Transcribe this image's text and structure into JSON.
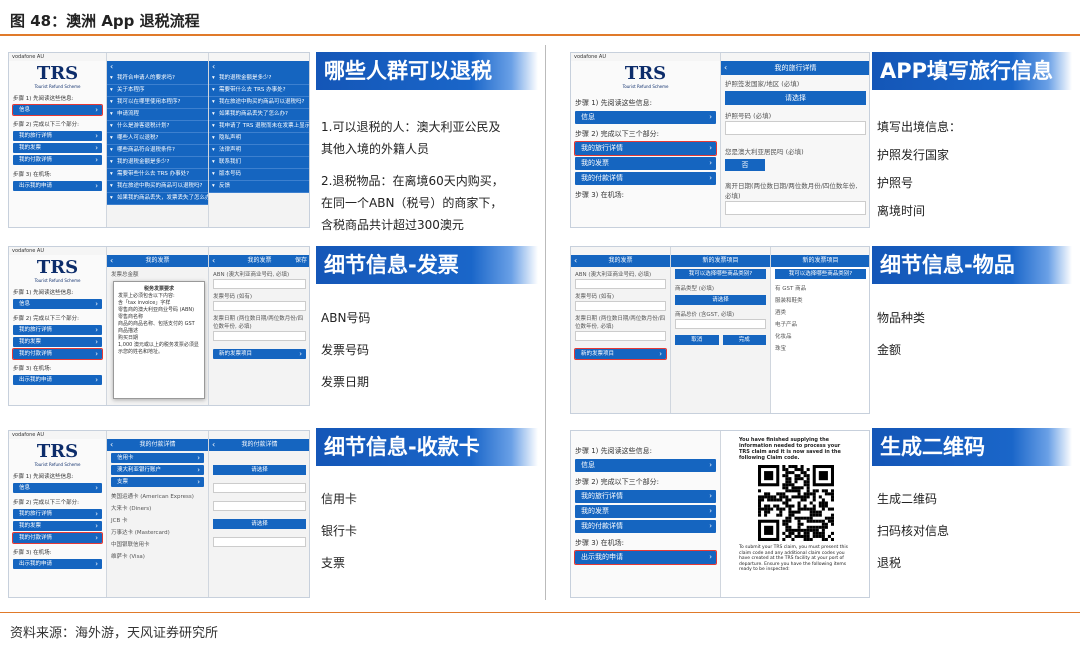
{
  "figure_title": "图 48：澳洲 App 退税流程",
  "source": "资料来源：海外游，天风证券研究所",
  "sections": {
    "who": {
      "heading": "哪些人群可以退税",
      "lines": [
        "1.可以退税的人：澳大利亚公民及其他入境的外籍人员",
        "2.退税物品：在离境60天内购买，在同一个ABN（税号）的商家下，含税商品共计超过300澳元"
      ]
    },
    "travel": {
      "heading": "APP填写旅行信息",
      "lines": [
        "填写出境信息：",
        "护照发行国家",
        "护照号",
        "离境时间"
      ]
    },
    "invoice": {
      "heading": "细节信息-发票",
      "lines": [
        "ABN号码",
        "发票号码",
        "发票日期"
      ]
    },
    "goods": {
      "heading": "细节信息-物品",
      "lines": [
        "物品种类",
        "金额"
      ]
    },
    "card": {
      "heading": "细节信息-收款卡",
      "lines": [
        "信用卡",
        "银行卡",
        "支票"
      ]
    },
    "qr": {
      "heading": "生成二维码",
      "lines": [
        "生成二维码",
        "扫码核对信息",
        "退税"
      ]
    }
  },
  "app": {
    "carrier": "vodafone AU",
    "logo": "TRS",
    "logo_sub": "Tourist Refund Scheme",
    "step1": "步骤 1) 先阅读这些信息:",
    "info_btn": "信息",
    "step2": "步骤 2) 完成以下三个部分:",
    "my_travel": "我的旅行详情",
    "my_invoice": "我的发票",
    "my_payment": "我的付款详情",
    "step3": "步骤 3) 在机场:",
    "show_claim": "出示我的申请",
    "faq_items": [
      "我符合申请人的要求吗?",
      "关于本程序",
      "我可以在哪里使用本程序?",
      "申请流程",
      "什么是游客退税计划?",
      "哪些人可以退税?",
      "哪些商品符合退税条件?",
      "我的退税金额是多少?",
      "需要带些什么去 TRS 办事处?",
      "我在旅途中购买的商品可以退税吗?",
      "如果我的商品丢失，发票丢失了怎么办?"
    ],
    "faq_items2": [
      "我的退税金额是多少?",
      "需要带什么去 TRS 办事处?",
      "我在旅途中购买的商品可以退税吗?",
      "如果我的商品丢失了怎么办?",
      "我申请了 TRS 退税而未在发票上显示怎么办?",
      "隐私声明",
      "法律声明",
      "联系我们",
      "版本号码",
      "反馈"
    ],
    "travel_nav": "我的旅行详情",
    "passport_country": "护照签发国家/地区 (必填)",
    "please_select": "请选择",
    "passport_no": "护照号码 (必填)",
    "is_resident": "您是澳大利亚居民吗 (必填)",
    "no": "否",
    "departure": "离开日期(两位数日期/两位数月份/四位数年份, 必填)",
    "invoice_nav": "我的发票",
    "save": "保存",
    "abn_label": "ABN (澳大利亚商业号码, 必填)",
    "invoice_no": "发票号码 (如有)",
    "invoice_date": "发票日期 (两位数日期/两位数月份/四位数年份, 必填)",
    "invoice_total": "发票总金额",
    "add_item": "新的发票项目",
    "modal_title": "税务发票要求",
    "modal_lines": [
      "发票上必须包含以下内容:",
      "含「tax invoice」字样",
      "零售商的澳大利亚商业号码 (ABN)",
      "零售商名称",
      "商品的商品名称、包括支付的 GST",
      "商品描述",
      "购买日期",
      "1,000 澳元或以上的税务发票必须显示您的姓名和地址。"
    ],
    "goods_nav": "新的发票项目",
    "goods_type": "商品类型 (必填)",
    "goods_amount": "商品总价 (含GST, 必填)",
    "cancel": "取消",
    "confirm": "完成",
    "goods_help_title": "我可以选择哪些商品类别?",
    "goods_help": [
      "有 GST 商品",
      "服装和鞋类",
      "酒类",
      "电子产品",
      "化妆品",
      "珠宝"
    ],
    "payment_nav": "我的付款详情",
    "card_types": [
      "信用卡",
      "澳大利亚银行账户",
      "支票"
    ],
    "card_list": [
      "美国运通卡 (American Express)",
      "大来卡 (Diners)",
      "JCB 卡",
      "万事达卡 (Mastercard)",
      "中国银联信用卡",
      "维萨卡 (Visa)"
    ],
    "qr_text_top": "You have finished supplying the information needed to process your TRS claim and it is now saved in the following Claim code.",
    "qr_text_bottom": "To submit your TRS claim, you must present this claim code and any additional claim codes you have created at the TRS facility at your port of departure. Ensure you have the following items ready to be inspected:"
  }
}
